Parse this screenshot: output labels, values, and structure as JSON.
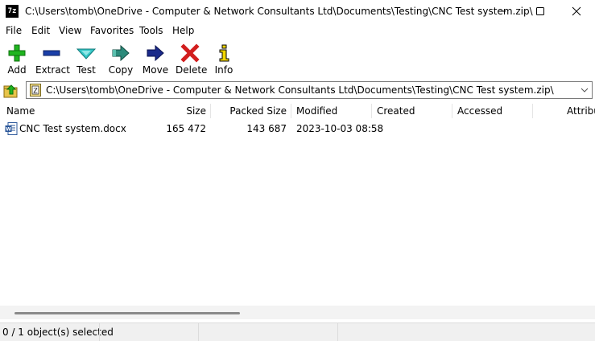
{
  "window": {
    "app_icon_text": "7z",
    "title": "C:\\Users\\tomb\\OneDrive - Computer & Network Consultants Ltd\\Documents\\Testing\\CNC Test system.zip\\"
  },
  "menu": [
    "File",
    "Edit",
    "View",
    "Favorites",
    "Tools",
    "Help"
  ],
  "toolbar": {
    "add": "Add",
    "extract": "Extract",
    "test": "Test",
    "copy": "Copy",
    "move": "Move",
    "delete": "Delete",
    "info": "Info"
  },
  "address": {
    "path": "C:\\Users\\tomb\\OneDrive - Computer & Network Consultants Ltd\\Documents\\Testing\\CNC Test system.zip\\"
  },
  "columns": [
    "Name",
    "Size",
    "Packed Size",
    "Modified",
    "Created",
    "Accessed",
    "Attribu"
  ],
  "files": [
    {
      "name": "CNC Test system.docx",
      "size": "165 472",
      "packed_size": "143 687",
      "modified": "2023-10-03 08:58",
      "created": "",
      "accessed": ""
    }
  ],
  "status": {
    "selection": "0 / 1 object(s) selected"
  },
  "icons": {
    "add": "plus-icon",
    "extract": "minus-icon",
    "test": "check-icon",
    "copy": "copy-arrow-icon",
    "move": "move-arrow-icon",
    "delete": "delete-x-icon",
    "info": "info-icon"
  },
  "colors": {
    "add_green": "#1fb51f",
    "extract_blue": "#1a3fa8",
    "test_cyan": "#33c6c6",
    "copy_teal": "#2b8a7a",
    "move_navy": "#1a2a8a",
    "delete_red": "#d21e1e",
    "info_yellow": "#f2d600"
  }
}
